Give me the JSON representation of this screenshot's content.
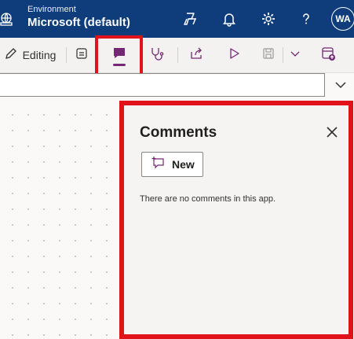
{
  "header": {
    "env_label": "Environment",
    "env_name": "Microsoft (default)",
    "avatar_initials": "WA",
    "icons": [
      "environment-icon",
      "copilot-icon",
      "bell-icon",
      "gear-icon",
      "help-icon"
    ]
  },
  "commandbar": {
    "editing_label": "Editing",
    "active_tab": "comments",
    "accent_color": "#742774",
    "icons": [
      "pencil-icon",
      "notes-icon",
      "comments-icon",
      "app-checker-icon",
      "share-icon",
      "play-icon",
      "save-icon",
      "chevron-down-icon",
      "publish-icon"
    ]
  },
  "formula_bar": {
    "value": ""
  },
  "comments_pane": {
    "title": "Comments",
    "new_button_label": "New",
    "empty_message": "There are no comments in this app."
  },
  "colors": {
    "header_bg": "#0f3d7c",
    "highlight": "#e0121a"
  }
}
